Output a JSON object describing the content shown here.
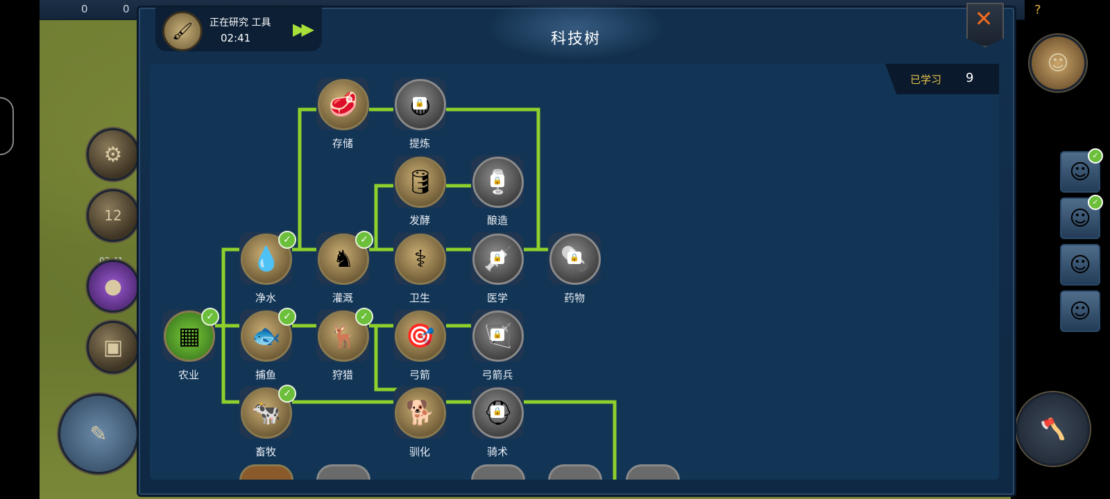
{
  "research": {
    "label": "正在研究 工具",
    "time": "02:41"
  },
  "title": "科技树",
  "learned": {
    "label": "已学习",
    "count": "9"
  },
  "side_timer": "02:41",
  "calendar_day": "12",
  "top_resources": [
    "0",
    "0"
  ],
  "help": "?",
  "nodes": [
    {
      "id": "storage",
      "label": "存储",
      "state": "unlocked",
      "icon": "meat-icon"
    },
    {
      "id": "refine",
      "label": "提炼",
      "state": "locked",
      "icon": "barrels-icon"
    },
    {
      "id": "ferment",
      "label": "发酵",
      "state": "unlocked",
      "icon": "barrel-icon"
    },
    {
      "id": "brew",
      "label": "酿造",
      "state": "locked",
      "icon": "wine-icon"
    },
    {
      "id": "water",
      "label": "净水",
      "state": "learned",
      "icon": "water-drops-icon"
    },
    {
      "id": "irrigate",
      "label": "灌溉",
      "state": "learned",
      "icon": "irrigation-icon"
    },
    {
      "id": "hygiene",
      "label": "卫生",
      "state": "unlocked",
      "icon": "caduceus-icon"
    },
    {
      "id": "medicine",
      "label": "医学",
      "state": "locked",
      "icon": "syringe-icon"
    },
    {
      "id": "drugs",
      "label": "药物",
      "state": "locked",
      "icon": "capsule-icon"
    },
    {
      "id": "agri",
      "label": "农业",
      "state": "learned",
      "icon": "farm-icon"
    },
    {
      "id": "fishing",
      "label": "捕鱼",
      "state": "learned",
      "icon": "fish-icon"
    },
    {
      "id": "hunting",
      "label": "狩猎",
      "state": "learned",
      "icon": "deer-icon"
    },
    {
      "id": "archery",
      "label": "弓箭",
      "state": "unlocked",
      "icon": "target-icon"
    },
    {
      "id": "archer",
      "label": "弓箭兵",
      "state": "locked",
      "icon": "bow-icon"
    },
    {
      "id": "herding",
      "label": "畜牧",
      "state": "learned",
      "icon": "cow-icon"
    },
    {
      "id": "domestic",
      "label": "驯化",
      "state": "unlocked",
      "icon": "dog-icon"
    },
    {
      "id": "riding",
      "label": "骑术",
      "state": "locked",
      "icon": "helmet-icon"
    }
  ],
  "colors": {
    "line": "#8fd02c",
    "learned_check": "#6cbf3a",
    "locked": "#8a8a8a",
    "accent": "#e8c24a"
  }
}
